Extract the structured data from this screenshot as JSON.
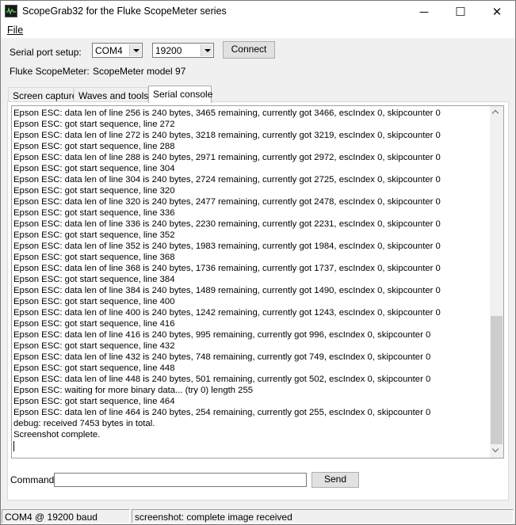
{
  "window": {
    "title": "ScopeGrab32 for the Fluke ScopeMeter series",
    "minimize_glyph": "─",
    "maximize_glyph": "☐",
    "close_glyph": "✕"
  },
  "menu": {
    "file_label": "File"
  },
  "serial": {
    "label": "Serial port setup:",
    "port_value": "COM4",
    "baud_value": "19200",
    "connect_label": "Connect"
  },
  "meter": {
    "label": "Fluke ScopeMeter:",
    "model": "ScopeMeter model 97"
  },
  "tabs": [
    {
      "label": "Screen capture",
      "active": false
    },
    {
      "label": "Waves and tools",
      "active": false
    },
    {
      "label": "Serial console",
      "active": true
    }
  ],
  "console": {
    "lines": [
      "Epson ESC: data len of line 256 is 240 bytes, 3465 remaining, currently got 3466, escIndex 0, skipcounter 0",
      "Epson ESC: got start sequence, line 272",
      "Epson ESC: data len of line 272 is 240 bytes, 3218 remaining, currently got 3219, escIndex 0, skipcounter 0",
      "Epson ESC: got start sequence, line 288",
      "Epson ESC: data len of line 288 is 240 bytes, 2971 remaining, currently got 2972, escIndex 0, skipcounter 0",
      "Epson ESC: got start sequence, line 304",
      "Epson ESC: data len of line 304 is 240 bytes, 2724 remaining, currently got 2725, escIndex 0, skipcounter 0",
      "Epson ESC: got start sequence, line 320",
      "Epson ESC: data len of line 320 is 240 bytes, 2477 remaining, currently got 2478, escIndex 0, skipcounter 0",
      "Epson ESC: got start sequence, line 336",
      "Epson ESC: data len of line 336 is 240 bytes, 2230 remaining, currently got 2231, escIndex 0, skipcounter 0",
      "Epson ESC: got start sequence, line 352",
      "Epson ESC: data len of line 352 is 240 bytes, 1983 remaining, currently got 1984, escIndex 0, skipcounter 0",
      "Epson ESC: got start sequence, line 368",
      "Epson ESC: data len of line 368 is 240 bytes, 1736 remaining, currently got 1737, escIndex 0, skipcounter 0",
      "Epson ESC: got start sequence, line 384",
      "Epson ESC: data len of line 384 is 240 bytes, 1489 remaining, currently got 1490, escIndex 0, skipcounter 0",
      "Epson ESC: got start sequence, line 400",
      "Epson ESC: data len of line 400 is 240 bytes, 1242 remaining, currently got 1243, escIndex 0, skipcounter 0",
      "Epson ESC: got start sequence, line 416",
      "Epson ESC: data len of line 416 is 240 bytes, 995 remaining, currently got 996, escIndex 0, skipcounter 0",
      "Epson ESC: got start sequence, line 432",
      "Epson ESC: data len of line 432 is 240 bytes, 748 remaining, currently got 749, escIndex 0, skipcounter 0",
      "Epson ESC: got start sequence, line 448",
      "Epson ESC: data len of line 448 is 240 bytes, 501 remaining, currently got 502, escIndex 0, skipcounter 0",
      "Epson ESC: waiting for more binary data... (try 0) length 255",
      "Epson ESC: got start sequence, line 464",
      "Epson ESC: data len of line 464 is 240 bytes, 254 remaining, currently got 255, escIndex 0, skipcounter 0",
      "debug: received 7453 bytes in total.",
      "Screenshot complete."
    ]
  },
  "command": {
    "label": "Command:",
    "value": "",
    "send_label": "Send"
  },
  "status": {
    "connection": "COM4 @ 19200 baud",
    "message": "screenshot: complete image received"
  }
}
